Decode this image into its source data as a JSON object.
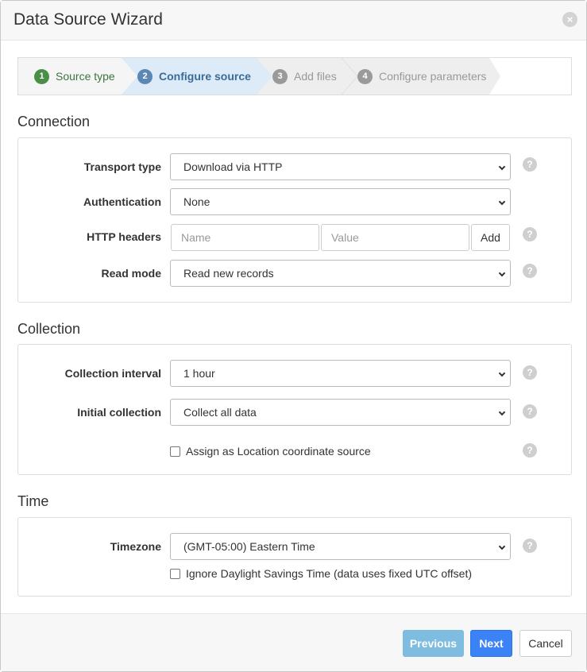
{
  "dialog": {
    "title": "Data Source Wizard",
    "close_icon": "×"
  },
  "wizard": {
    "steps": [
      {
        "number": "1",
        "label": "Source type",
        "state": "complete"
      },
      {
        "number": "2",
        "label": "Configure source",
        "state": "active"
      },
      {
        "number": "3",
        "label": "Add files",
        "state": "pending"
      },
      {
        "number": "4",
        "label": "Configure parameters",
        "state": "pending"
      }
    ]
  },
  "connection": {
    "title": "Connection",
    "transport_type": {
      "label": "Transport type",
      "value": "Download via HTTP"
    },
    "authentication": {
      "label": "Authentication",
      "value": "None"
    },
    "http_headers": {
      "label": "HTTP headers",
      "name_placeholder": "Name",
      "value_placeholder": "Value",
      "add_label": "Add"
    },
    "read_mode": {
      "label": "Read mode",
      "value": "Read new records"
    }
  },
  "collection": {
    "title": "Collection",
    "interval": {
      "label": "Collection interval",
      "value": "1 hour"
    },
    "initial": {
      "label": "Initial collection",
      "value": "Collect all data"
    },
    "location_checkbox": {
      "label": "Assign as Location coordinate source",
      "checked": false
    }
  },
  "time": {
    "title": "Time",
    "timezone": {
      "label": "Timezone",
      "value": "(GMT-05:00) Eastern Time"
    },
    "dst_checkbox": {
      "label": "Ignore Daylight Savings Time (data uses fixed UTC offset)",
      "checked": false
    }
  },
  "help_icon": "?",
  "footer": {
    "previous": "Previous",
    "next": "Next",
    "cancel": "Cancel"
  },
  "colors": {
    "step_complete": "#3c763d",
    "step_active_bg": "#dcebf7",
    "primary_button": "#3b82f6",
    "previous_button": "#7fbde0"
  }
}
